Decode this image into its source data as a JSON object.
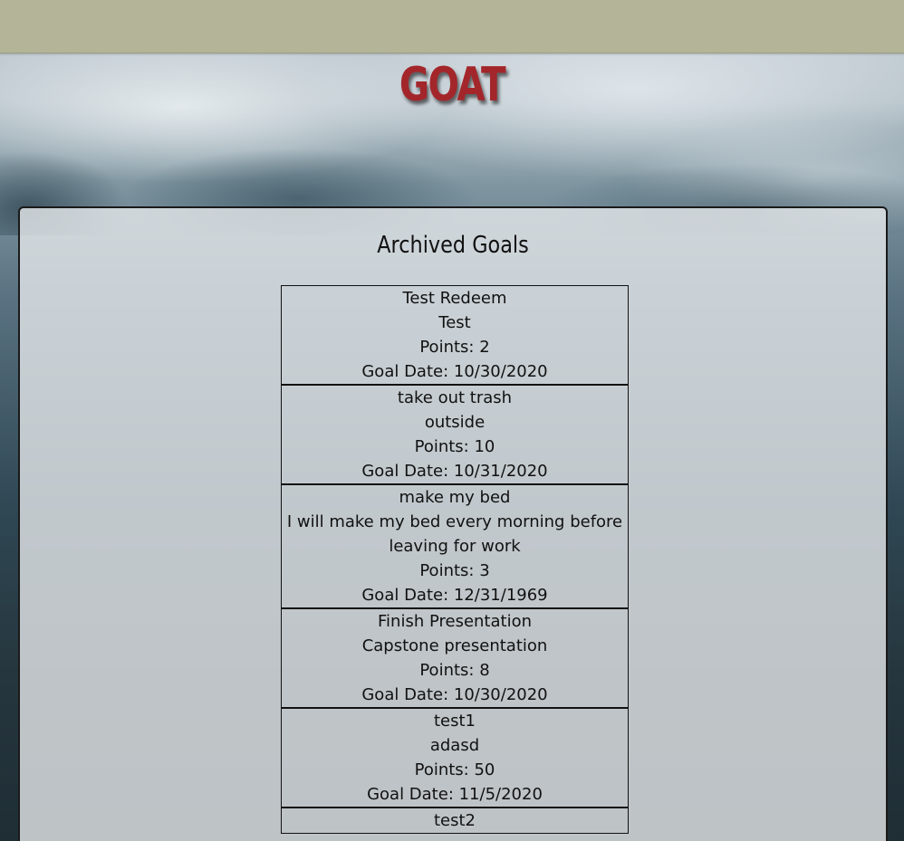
{
  "brand": {
    "title": "GOAT",
    "color": "#a3262b"
  },
  "header_bar": {
    "color": "#b4b598"
  },
  "panel": {
    "title": "Archived Goals"
  },
  "goals": [
    {
      "title": "Test Redeem",
      "description": "Test",
      "points": "Points: 2",
      "goal_date": "Goal Date: 10/30/2020"
    },
    {
      "title": "take out trash",
      "description": "outside",
      "points": "Points: 10",
      "goal_date": "Goal Date: 10/31/2020"
    },
    {
      "title": "make my bed",
      "description": "I will make my bed every morning before leaving for work",
      "points": "Points: 3",
      "goal_date": "Goal Date: 12/31/1969"
    },
    {
      "title": "Finish Presentation",
      "description": "Capstone presentation",
      "points": "Points: 8",
      "goal_date": "Goal Date: 10/30/2020"
    },
    {
      "title": "test1",
      "description": "adasd",
      "points": "Points: 50",
      "goal_date": "Goal Date: 11/5/2020"
    },
    {
      "title": "test2",
      "description": "",
      "points": "",
      "goal_date": ""
    }
  ]
}
